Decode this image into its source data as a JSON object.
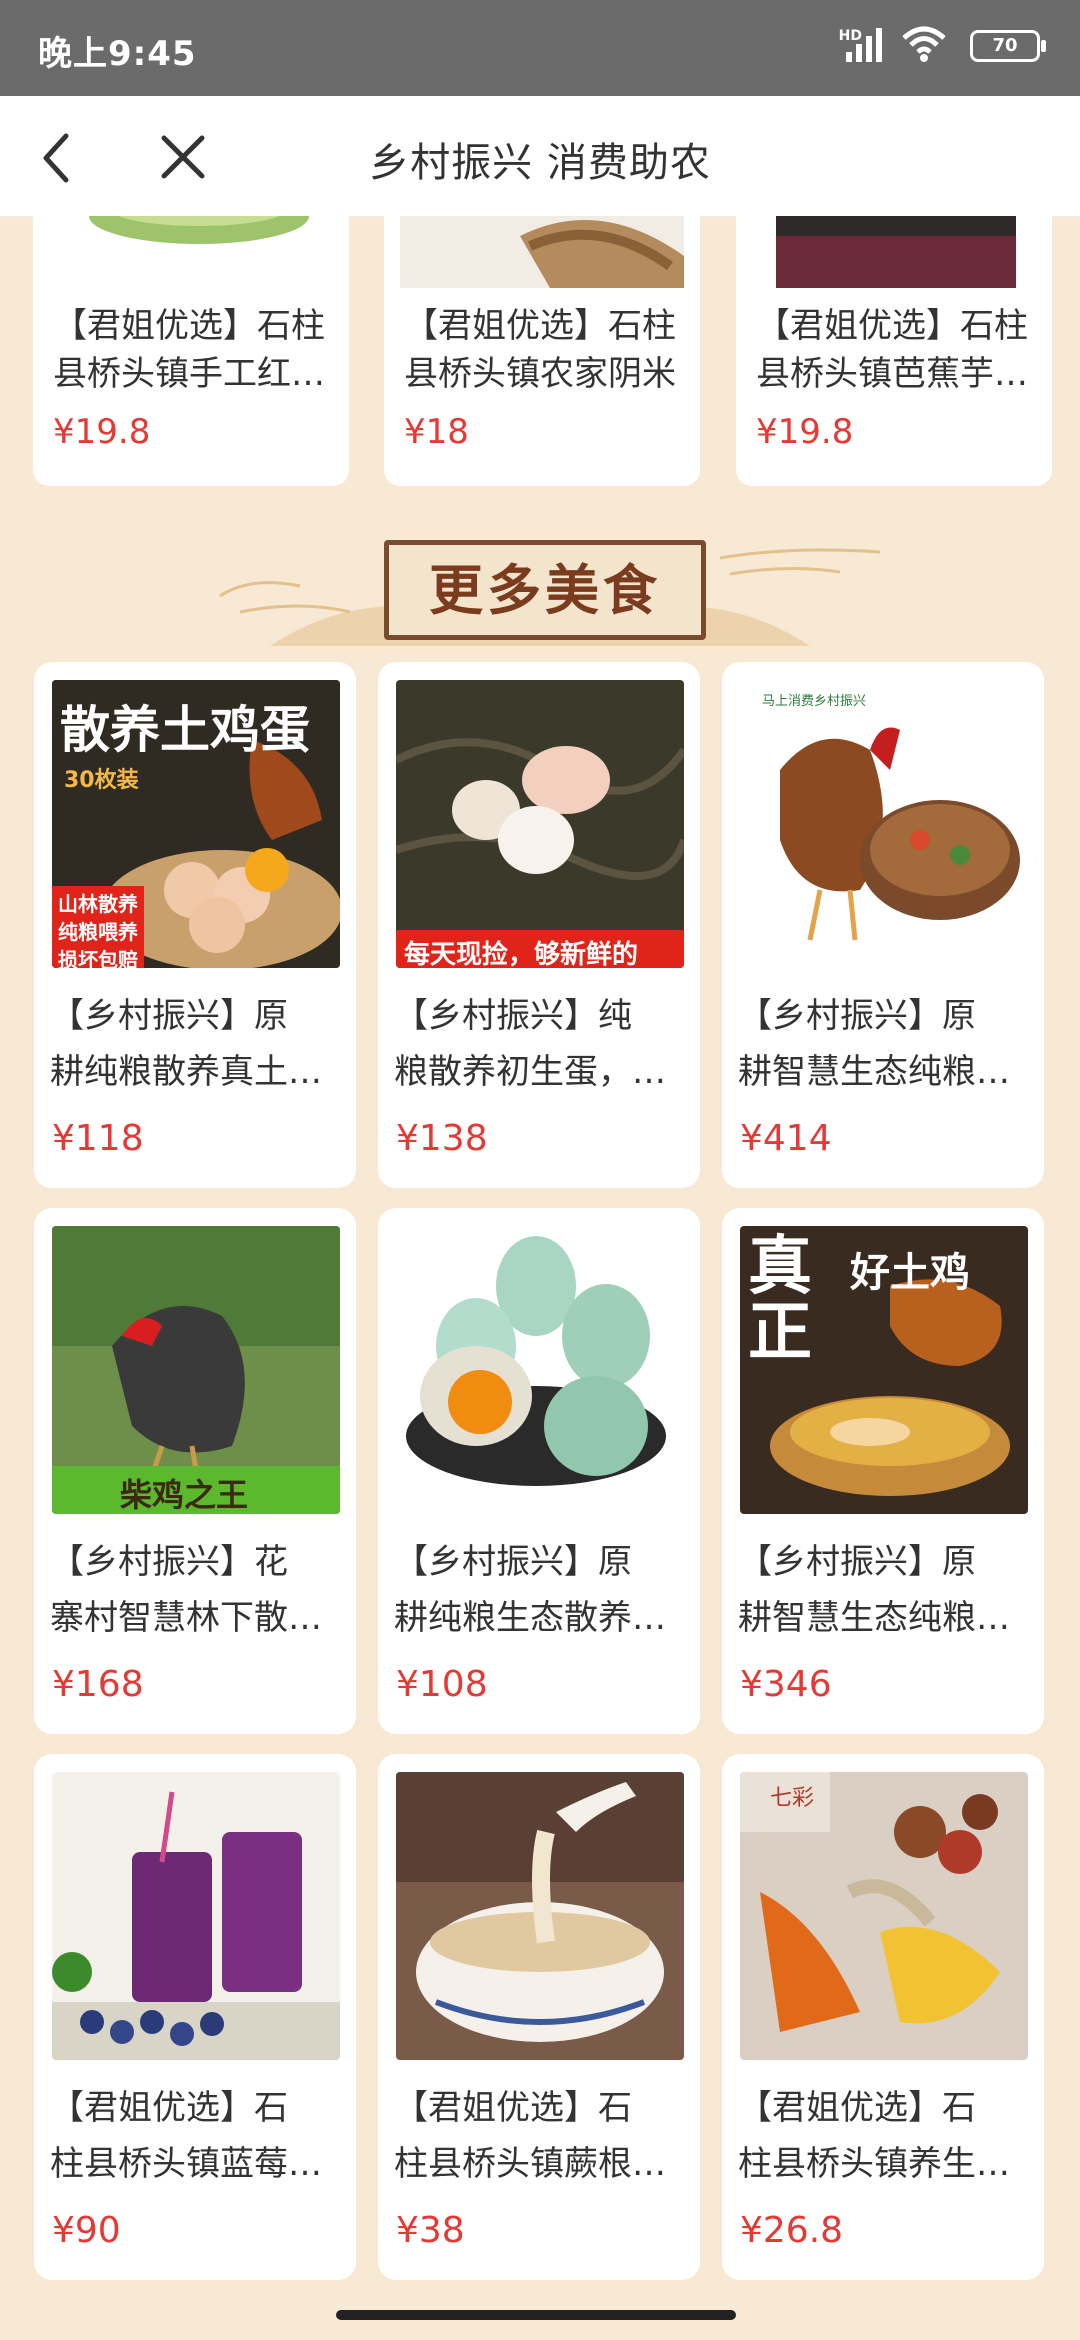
{
  "status_bar": {
    "time": "晚上9:45",
    "network": "HD",
    "battery": "70"
  },
  "header": {
    "title": "乡村振兴 消费助农"
  },
  "top_products": [
    {
      "title": "【君姐优选】石柱县桥头镇手工红…",
      "price": "¥19.8"
    },
    {
      "title": "【君姐优选】石柱县桥头镇农家阴米",
      "price": "¥18"
    },
    {
      "title": "【君姐优选】石柱县桥头镇芭蕉芋…",
      "price": "¥19.8"
    }
  ],
  "section": {
    "title": "更多美食"
  },
  "products": [
    {
      "line1": "【乡村振兴】原",
      "line2": "耕纯粮散养真土…",
      "price": "¥118",
      "image_text": {
        "headline": "散养土鸡蛋",
        "count": "30枚装",
        "tags": [
          "山林散养",
          "纯粮喂养",
          "损坏包赔"
        ]
      }
    },
    {
      "line1": "【乡村振兴】纯",
      "line2": "粮散养初生蛋，…",
      "price": "¥138",
      "image_text": {
        "banner": "每天现捡，够新鲜的"
      }
    },
    {
      "line1": "【乡村振兴】原",
      "line2": "耕智慧生态纯粮…",
      "price": "¥414",
      "image_text": {
        "logo": "马上消费乡村振兴"
      }
    },
    {
      "line1": "【乡村振兴】花",
      "line2": "寨村智慧林下散…",
      "price": "¥168",
      "image_text": {
        "banner": "柴鸡之王"
      }
    },
    {
      "line1": "【乡村振兴】原",
      "line2": "耕纯粮生态散养…",
      "price": "¥108",
      "image_text": {}
    },
    {
      "line1": "【乡村振兴】原",
      "line2": "耕智慧生态纯粮…",
      "price": "¥346",
      "image_text": {
        "big": "真正",
        "headline": "好土鸡"
      }
    },
    {
      "line1": "【君姐优选】石",
      "line2": "柱县桥头镇蓝莓…",
      "price": "¥90",
      "image_text": {}
    },
    {
      "line1": "【君姐优选】石",
      "line2": "柱县桥头镇蕨根…",
      "price": "¥38",
      "image_text": {}
    },
    {
      "line1": "【君姐优选】石",
      "line2": "柱县桥头镇养生…",
      "price": "¥26.8",
      "image_text": {
        "logo": "七彩"
      }
    }
  ]
}
